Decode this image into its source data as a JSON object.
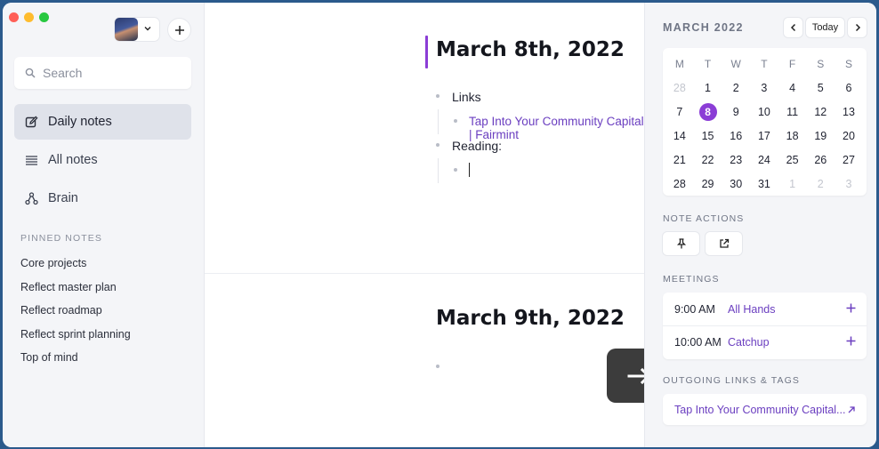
{
  "sidebar": {
    "search_placeholder": "Search",
    "nav": [
      {
        "label": "Daily notes",
        "icon": "edit-icon",
        "active": true
      },
      {
        "label": "All notes",
        "icon": "list-icon",
        "active": false
      },
      {
        "label": "Brain",
        "icon": "brain-graph-icon",
        "active": false
      }
    ],
    "pinned_title": "PINNED NOTES",
    "pinned": [
      "Core projects",
      "Reflect master plan",
      "Reflect roadmap",
      "Reflect sprint planning",
      "Top of mind"
    ]
  },
  "notes": [
    {
      "title": "March 8th, 2022",
      "items": [
        {
          "text": "Links"
        },
        {
          "link": "Tap Into Your Community Capital | Fairmint"
        },
        {
          "text": "Reading:"
        }
      ]
    },
    {
      "title": "March 9th, 2022"
    }
  ],
  "calendar": {
    "month": "MARCH 2022",
    "today_label": "Today",
    "weekdays": [
      "M",
      "T",
      "W",
      "T",
      "F",
      "S",
      "S"
    ],
    "days": [
      "28",
      "1",
      "2",
      "3",
      "4",
      "5",
      "6",
      "7",
      "8",
      "9",
      "10",
      "11",
      "12",
      "13",
      "14",
      "15",
      "16",
      "17",
      "18",
      "19",
      "20",
      "21",
      "22",
      "23",
      "24",
      "25",
      "26",
      "27",
      "28",
      "29",
      "30",
      "31",
      "1",
      "2",
      "3"
    ],
    "muted_days": [
      0,
      32,
      33,
      34
    ],
    "today_index": 8
  },
  "note_actions_title": "NOTE ACTIONS",
  "meetings_title": "MEETINGS",
  "meetings": [
    {
      "time": "9:00 AM",
      "name": "All Hands"
    },
    {
      "time": "10:00 AM",
      "name": "Catchup"
    }
  ],
  "outgoing_title": "OUTGOING LINKS & TAGS",
  "outgoing_link": "Tap Into Your Community Capital...",
  "colors": {
    "accent": "#8b3dd6",
    "link": "#6b3fc0"
  }
}
